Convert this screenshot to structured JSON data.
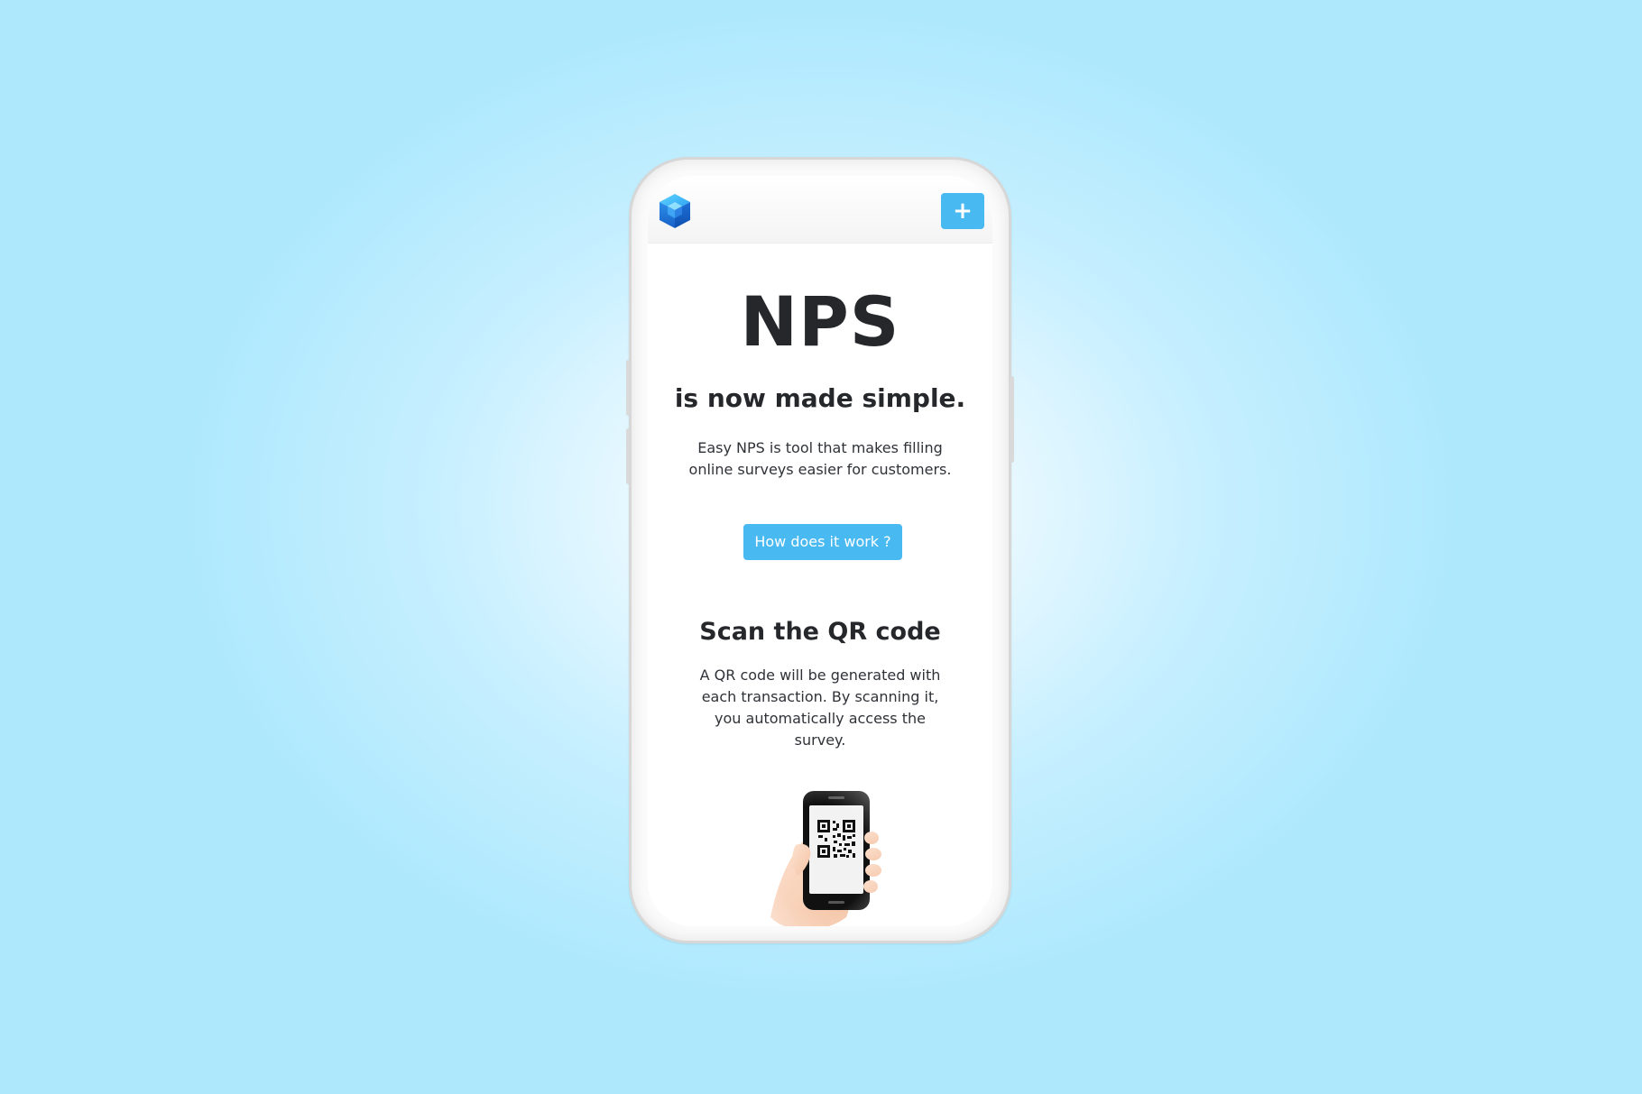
{
  "header": {
    "logo_icon": "cube-logo-icon",
    "add_icon": "plus-icon",
    "add_label": "+"
  },
  "hero": {
    "title": "NPS",
    "subtitle": "is now made simple.",
    "description": "Easy NPS is tool that makes filling online surveys easier for customers.",
    "cta_label": "How does it work ?"
  },
  "scan_section": {
    "title": "Scan the QR code",
    "description": "A QR code will be generated with each transaction. By scanning it, you automatically access the survey.",
    "illustration_icon": "hand-phone-qr-icon"
  },
  "colors": {
    "accent": "#49b9f2",
    "text": "#25272b",
    "background": "#c6efff"
  }
}
